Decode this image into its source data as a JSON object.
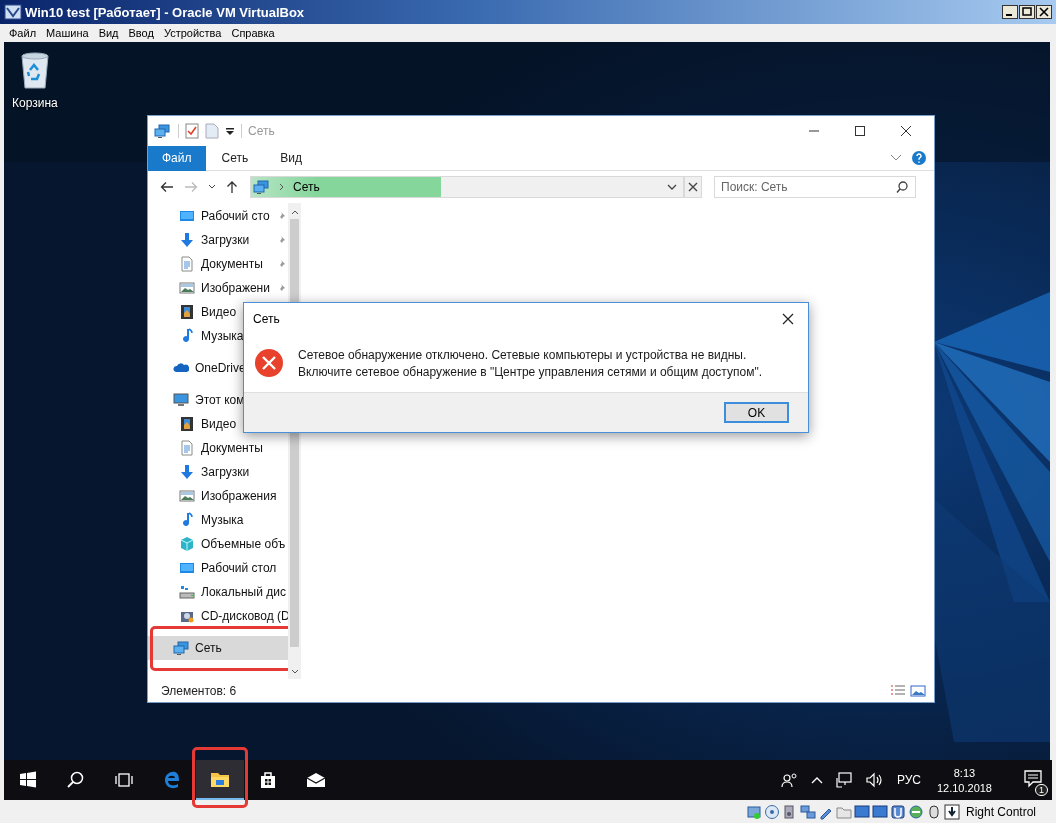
{
  "vbox": {
    "title": "Win10 test [Работает] - Oracle VM VirtualBox",
    "menu": [
      "Файл",
      "Машина",
      "Вид",
      "Ввод",
      "Устройства",
      "Справка"
    ],
    "status_icons": [
      {
        "kind": "disk"
      },
      {
        "kind": "optical"
      },
      {
        "kind": "audio"
      },
      {
        "kind": "network"
      },
      {
        "kind": "usb"
      },
      {
        "kind": "folder"
      },
      {
        "kind": "display"
      },
      {
        "kind": "display"
      },
      {
        "kind": "capture"
      },
      {
        "kind": "cpu"
      },
      {
        "kind": "mouse"
      },
      {
        "kind": "keyboard"
      }
    ],
    "host_key": "Right Control"
  },
  "desktop_icons": [
    {
      "label": "Корзина"
    }
  ],
  "explorer": {
    "title": "Сеть",
    "ribbon_tabs": [
      {
        "label": "Файл",
        "selected": true
      },
      {
        "label": "Сеть",
        "selected": false
      },
      {
        "label": "Вид",
        "selected": false
      }
    ],
    "address": {
      "text": "Сеть",
      "level": 0.44
    },
    "search": {
      "placeholder": "Поиск: Сеть"
    },
    "nav": [
      {
        "label": "Рабочий сто",
        "kind": "desktop",
        "pinned": true,
        "selected": false,
        "highlighted": false
      },
      {
        "label": "Загрузки",
        "kind": "downloads",
        "pinned": true,
        "selected": false,
        "highlighted": false
      },
      {
        "label": "Документы",
        "kind": "documents",
        "pinned": true,
        "selected": false,
        "highlighted": false
      },
      {
        "label": "Изображени",
        "kind": "pictures",
        "pinned": true,
        "selected": false,
        "highlighted": false
      },
      {
        "label": "Видео",
        "kind": "video",
        "selected": false,
        "highlighted": false
      },
      {
        "label": "Музыка",
        "kind": "music",
        "selected": false,
        "highlighted": false
      },
      {
        "label": "OneDrive",
        "kind": "onedrive",
        "group": true,
        "selected": false,
        "highlighted": false
      },
      {
        "label": "Этот ком",
        "kind": "computer",
        "group": true,
        "selected": false,
        "highlighted": false,
        "children": [
          {
            "label": "Видео",
            "kind": "video",
            "selected": false,
            "highlighted": false
          },
          {
            "label": "Документы",
            "kind": "documents",
            "selected": false,
            "highlighted": false
          },
          {
            "label": "Загрузки",
            "kind": "downloads",
            "selected": false,
            "highlighted": false
          },
          {
            "label": "Изображения",
            "kind": "pictures",
            "selected": false,
            "highlighted": false
          },
          {
            "label": "Музыка",
            "kind": "music",
            "selected": false,
            "highlighted": false
          },
          {
            "label": "Объемные объ",
            "kind": "objects",
            "selected": false,
            "highlighted": false
          },
          {
            "label": "Рабочий стол",
            "kind": "desktop",
            "selected": false,
            "highlighted": false
          },
          {
            "label": "Локальный дис",
            "kind": "disk",
            "selected": false,
            "highlighted": false
          },
          {
            "label": "CD-дисковод (D",
            "kind": "cd",
            "selected": false,
            "highlighted": false
          }
        ]
      },
      {
        "label": "Сеть",
        "kind": "network",
        "group": true,
        "selected": true,
        "highlighted": true
      }
    ],
    "status": "Элементов: 6"
  },
  "dialog": {
    "title": "Сеть",
    "message_lines": [
      "Сетевое обнаружение отключено. Сетевые компьютеры и устройства не видны.",
      "Включите сетевое обнаружение в \"Центре управления сетями и общим доступом\"."
    ],
    "button": "OK"
  },
  "taskbar": {
    "items": [
      {
        "kind": "start",
        "active": false,
        "highlighted": false
      },
      {
        "kind": "search",
        "active": false,
        "highlighted": false
      },
      {
        "kind": "taskview",
        "active": false,
        "highlighted": false
      },
      {
        "kind": "edge",
        "active": false,
        "highlighted": false
      },
      {
        "kind": "explorer",
        "active": true,
        "highlighted": true
      },
      {
        "kind": "store",
        "active": false,
        "highlighted": false
      },
      {
        "kind": "mail",
        "active": false,
        "highlighted": false
      }
    ],
    "language": "РУС",
    "time": "8:13",
    "date": "12.10.2018",
    "notifications": "1"
  }
}
